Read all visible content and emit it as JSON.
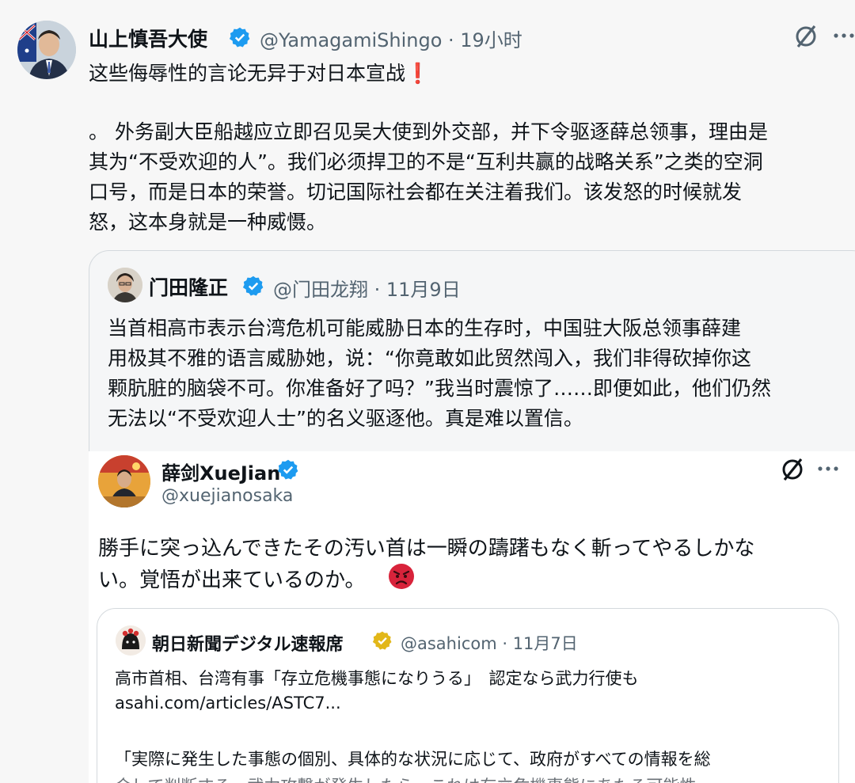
{
  "main_tweet": {
    "name": "山上慎吾大使",
    "handle_time": "@YamagamiShingo · 19小时",
    "line1": "这些侮辱性的言论无异于对日本宣战",
    "exclaim": "❗",
    "para": [
      "。 外务副大臣船越应立即召见吴大使到外交部，并下令驱逐薛总领事，理由是",
      "其为“不受欢迎的人”。我们必须捍卫的不是“互利共赢的战略关系”之类的空洞",
      "口号，而是日本的荣誉。切记国际社会都在关注着我们。该发怒的时候就发",
      "怒，这本身就是一种威慑。"
    ]
  },
  "quoted_tweet": {
    "name": "门田隆正",
    "handle_date": "@门田龙翔 · 11月9日",
    "lines": [
      "当首相高市表示台湾危机可能威胁日本的生存时，中国驻大阪总领事薛建",
      "用极其不雅的语言威胁她，说：“你竟敢如此贸然闯入，我们非得砍掉你这",
      "颗肮脏的脑袋不可。你准备好了吗？”我当时震惊了……即便如此，他们仍然",
      "无法以“不受欢迎人士”的名义驱逐他。真是难以置信。"
    ]
  },
  "xue_tweet": {
    "name": "薛剑XueJian",
    "handle": "@xuejianosaka",
    "lines": [
      "勝手に突っ込んできたその汚い首は一瞬の躊躇もなく斬ってやるしかな",
      "い。覚悟が出来ているのか。"
    ],
    "emoji": "angry-face"
  },
  "asahi_tweet": {
    "name": "朝日新聞デジタル速報席",
    "handle_date": "@asahicom · 11月7日",
    "headline": "高市首相、台湾有事「存立危機事態になりうる」　認定なら武力行使も",
    "link": "asahi.com/articles/ASTC7...",
    "line3": "「実際に発生した事態の個別、具体的な状況に応じて、政府がすべての情報を総",
    "line4": "合して判断する。武力攻撃が発生したら、これは存立危機事態にあたる可能性"
  },
  "icons": {
    "grok": "grok-icon",
    "more": "more-icon",
    "verified": "verified-badge-icon"
  },
  "colors": {
    "verified_blue": "#1d9bf0",
    "verified_gold": "#e2b719",
    "exclaim_red": "#e0242c",
    "angry_red": "#d8233b"
  }
}
